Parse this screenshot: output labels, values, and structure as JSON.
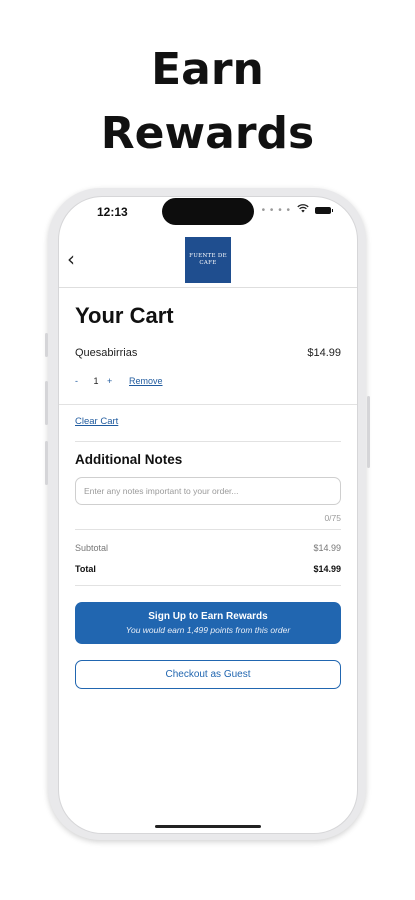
{
  "headline": {
    "line1": "Earn",
    "line2": "Rewards"
  },
  "status_bar": {
    "time": "12:13",
    "signal_dots": "• • • •",
    "wifi_icon": "wifi-icon",
    "battery_icon": "battery-icon"
  },
  "nav": {
    "back_icon": "chevron-left-icon",
    "back_glyph": "‹",
    "logo_line1": "FUENTE DE",
    "logo_line2": "CAFE"
  },
  "cart": {
    "title": "Your Cart",
    "items": [
      {
        "name": "Quesabirrias",
        "price": "$14.99",
        "quantity": "1",
        "decrement": "-",
        "increment": "+",
        "remove_label": "Remove"
      }
    ],
    "clear_label": "Clear Cart"
  },
  "notes": {
    "title": "Additional Notes",
    "placeholder": "Enter any notes important to your order...",
    "value": "",
    "counter": "0/75"
  },
  "totals": {
    "subtotal_label": "Subtotal",
    "subtotal_value": "$14.99",
    "total_label": "Total",
    "total_value": "$14.99"
  },
  "actions": {
    "rewards_title": "Sign Up to Earn Rewards",
    "rewards_subtitle": "You would earn 1,499 points from this order",
    "guest_label": "Checkout as Guest"
  },
  "colors": {
    "accent": "#2166b0",
    "logo_bg": "#1f4e8f",
    "link": "#1f5a9e"
  }
}
